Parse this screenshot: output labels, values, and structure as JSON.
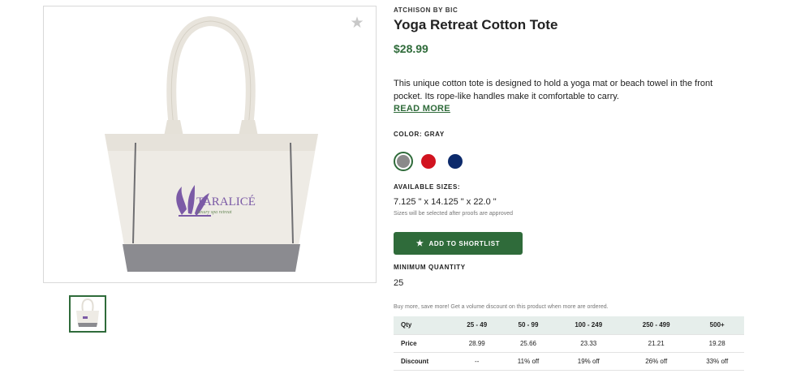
{
  "product": {
    "brand": "ATCHISON BY BIC",
    "title": "Yoga Retreat Cotton Tote",
    "price": "$28.99",
    "description": "This unique cotton tote is designed to hold a yoga mat or beach towel in the front pocket. Its rope-like handles make it comfortable to carry.",
    "read_more": "READ MORE",
    "favorite_icon": "star-icon",
    "image_logo_text": "TARALICÉ",
    "image_logo_tagline": "luxury spa retreat"
  },
  "color": {
    "label": "COLOR: GRAY",
    "swatches": [
      {
        "name": "gray",
        "hex": "#8a8a8a",
        "selected": true
      },
      {
        "name": "red",
        "hex": "#d1131f",
        "selected": false
      },
      {
        "name": "navy",
        "hex": "#0c2a6b",
        "selected": false
      }
    ]
  },
  "sizes": {
    "label": "AVAILABLE SIZES:",
    "value": "7.125 \" x 14.125 \" x 22.0 \"",
    "note": "Sizes will be selected after proofs are approved"
  },
  "shortlist": {
    "label": "ADD TO SHORTLIST",
    "icon": "star-icon"
  },
  "minimum": {
    "label": "MINIMUM QUANTITY",
    "value": "25"
  },
  "pricing": {
    "promo": "Buy more, save more! Get a volume discount on this product when more are ordered.",
    "rows": [
      {
        "label": "Qty",
        "cells": [
          "25 - 49",
          "50 - 99",
          "100 - 249",
          "250 - 499",
          "500+"
        ]
      },
      {
        "label": "Price",
        "cells": [
          "28.99",
          "25.66",
          "23.33",
          "21.21",
          "19.28"
        ]
      },
      {
        "label": "Discount",
        "cells": [
          "--",
          "11% off",
          "19% off",
          "26% off",
          "33% off"
        ]
      }
    ]
  },
  "colors": {
    "accent": "#2f6b3a",
    "table_header_bg": "#e6eeeb"
  }
}
